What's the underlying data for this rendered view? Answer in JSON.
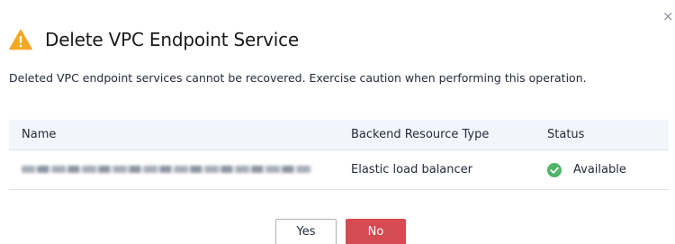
{
  "dialog": {
    "close_glyph": "×",
    "icon": "warning-triangle-icon",
    "title": "Delete VPC Endpoint Service",
    "message": "Deleted VPC endpoint services cannot be recovered. Exercise caution when performing this operation."
  },
  "table": {
    "columns": [
      "Name",
      "Backend Resource Type",
      "Status"
    ],
    "rows": [
      {
        "name": "",
        "name_obscured": true,
        "backend_resource_type": "Elastic load balancer",
        "status": "Available",
        "status_icon": "check-circle-icon"
      }
    ]
  },
  "buttons": {
    "yes": "Yes",
    "no": "No"
  },
  "colors": {
    "warning": "#f5a623",
    "success": "#50b46a",
    "danger": "#d64a52",
    "header_bg": "#f2f5fc"
  }
}
